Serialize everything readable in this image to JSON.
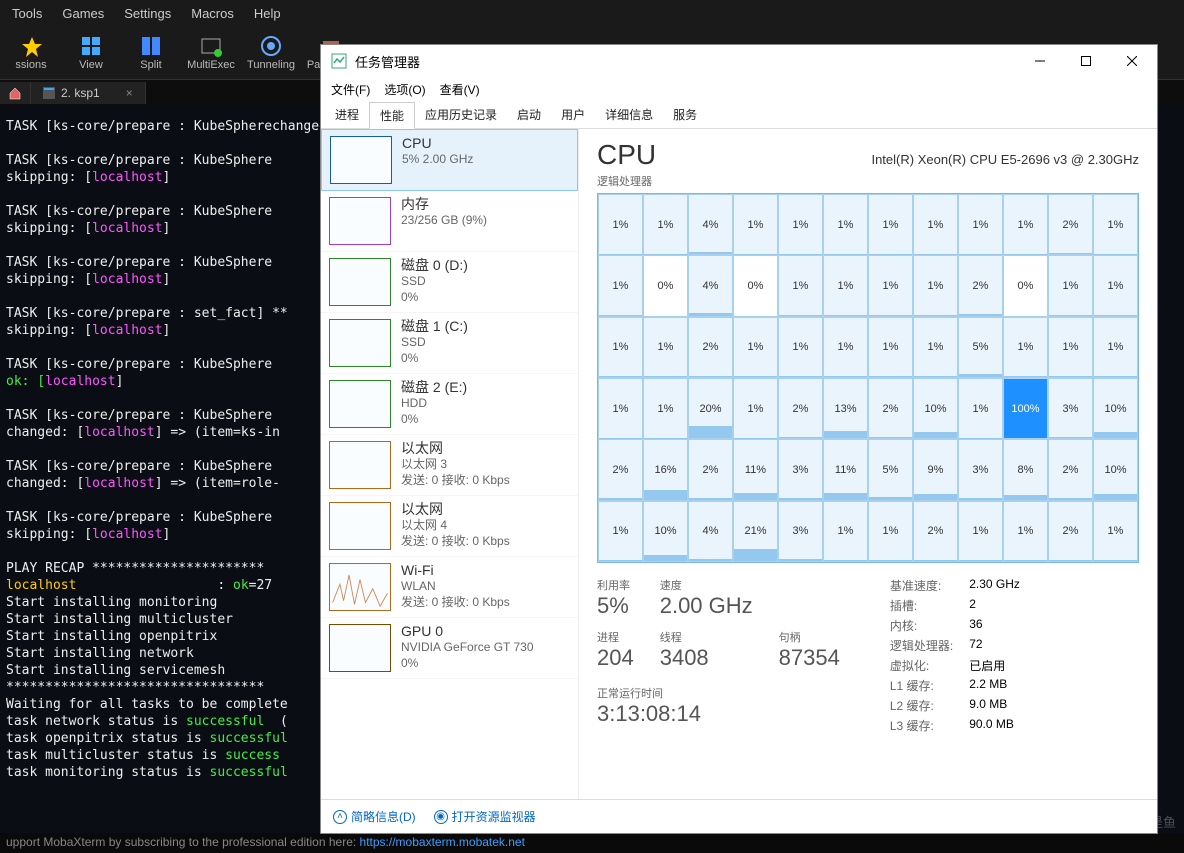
{
  "moba": {
    "menu": [
      "Tools",
      "Games",
      "Settings",
      "Macros",
      "Help"
    ],
    "toolbar": [
      {
        "label": "ssions",
        "icon": "star"
      },
      {
        "label": "View",
        "icon": "grid"
      },
      {
        "label": "Split",
        "icon": "split"
      },
      {
        "label": "MultiExec",
        "icon": "multi"
      },
      {
        "label": "Tunneling",
        "icon": "tunnel"
      },
      {
        "label": "Packages",
        "icon": "pkg"
      }
    ],
    "tab_label": "2. ksp1",
    "footer_text": "upport MobaXterm by subscribing to the professional edition here:  ",
    "footer_link": "https://mobaxterm.mobatek.net"
  },
  "terminal_lines": [
    {
      "t": "TASK [ks-core/prepare : KubeSphere",
      "c": ""
    },
    {
      "t": "changed: [",
      "c": ""
    },
    {
      "t": "localhost",
      "c": "m"
    },
    {
      "t": "]",
      "c": "",
      "nl": true
    },
    {
      "t": "",
      "nl": true
    },
    {
      "t": "TASK [ks-core/prepare : KubeSphere",
      "nl": true
    },
    {
      "t": "skipping: [",
      "c": ""
    },
    {
      "t": "localhost",
      "c": "m"
    },
    {
      "t": "]",
      "nl": true
    },
    {
      "t": "",
      "nl": true
    },
    {
      "t": "TASK [ks-core/prepare : KubeSphere",
      "nl": true
    },
    {
      "t": "skipping: [",
      "c": ""
    },
    {
      "t": "localhost",
      "c": "m"
    },
    {
      "t": "]",
      "nl": true
    },
    {
      "t": "",
      "nl": true
    },
    {
      "t": "TASK [ks-core/prepare : KubeSphere",
      "nl": true
    },
    {
      "t": "skipping: [",
      "c": ""
    },
    {
      "t": "localhost",
      "c": "m"
    },
    {
      "t": "]",
      "nl": true
    },
    {
      "t": "",
      "nl": true
    },
    {
      "t": "TASK [ks-core/prepare : set_fact] **",
      "nl": true
    },
    {
      "t": "skipping: [",
      "c": ""
    },
    {
      "t": "localhost",
      "c": "m"
    },
    {
      "t": "]",
      "nl": true
    },
    {
      "t": "",
      "nl": true
    },
    {
      "t": "TASK [ks-core/prepare : KubeSphere",
      "nl": true
    },
    {
      "t": "ok: [",
      "c": "g"
    },
    {
      "t": "localhost",
      "c": "m"
    },
    {
      "t": "]",
      "nl": true
    },
    {
      "t": "",
      "nl": true
    },
    {
      "t": "TASK [ks-core/prepare : KubeSphere",
      "nl": true
    },
    {
      "t": "changed: [",
      "c": ""
    },
    {
      "t": "localhost",
      "c": "m"
    },
    {
      "t": "] => (item=ks-in",
      "nl": true
    },
    {
      "t": "",
      "nl": true
    },
    {
      "t": "TASK [ks-core/prepare : KubeSphere",
      "nl": true
    },
    {
      "t": "changed: [",
      "c": ""
    },
    {
      "t": "localhost",
      "c": "m"
    },
    {
      "t": "] => (item=role-",
      "nl": true
    },
    {
      "t": "",
      "nl": true
    },
    {
      "t": "TASK [ks-core/prepare : KubeSphere",
      "nl": true
    },
    {
      "t": "skipping: [",
      "c": ""
    },
    {
      "t": "localhost",
      "c": "m"
    },
    {
      "t": "]",
      "nl": true
    },
    {
      "t": "",
      "nl": true
    },
    {
      "t": "PLAY RECAP **********************",
      "nl": true
    },
    {
      "t": "localhost",
      "c": "y"
    },
    {
      "t": "                  : ",
      "c": ""
    },
    {
      "t": "ok",
      "c": "g"
    },
    {
      "t": "=27",
      "nl": true
    },
    {
      "t": "Start installing monitoring",
      "nl": true
    },
    {
      "t": "Start installing multicluster",
      "nl": true
    },
    {
      "t": "Start installing openpitrix",
      "nl": true
    },
    {
      "t": "Start installing network",
      "nl": true
    },
    {
      "t": "Start installing servicemesh",
      "nl": true
    },
    {
      "t": "*********************************",
      "nl": true
    },
    {
      "t": "Waiting for all tasks to be complete",
      "nl": true
    },
    {
      "t": "task network status is ",
      "c": ""
    },
    {
      "t": "successful",
      "c": "g"
    },
    {
      "t": "  (",
      "nl": true
    },
    {
      "t": "task openpitrix status is ",
      "c": ""
    },
    {
      "t": "successful",
      "c": "g"
    },
    {
      "t": "",
      "nl": true
    },
    {
      "t": "task multicluster status is ",
      "c": ""
    },
    {
      "t": "success",
      "c": "g"
    },
    {
      "t": "",
      "nl": true
    },
    {
      "t": "task monitoring status is ",
      "c": ""
    },
    {
      "t": "successful",
      "c": "g"
    },
    {
      "t": "",
      "nl": true
    }
  ],
  "watermark": "CSDN @虎鲸不是鱼",
  "taskmgr": {
    "title": "任务管理器",
    "menu": {
      "file": "文件(F)",
      "options": "选项(O)",
      "view": "查看(V)"
    },
    "tabs": [
      "进程",
      "性能",
      "应用历史记录",
      "启动",
      "用户",
      "详细信息",
      "服务"
    ],
    "active_tab": 1,
    "sidebar": [
      {
        "name": "CPU",
        "sub": "5%  2.00 GHz",
        "type": "cpu",
        "active": true
      },
      {
        "name": "内存",
        "sub": "23/256 GB (9%)",
        "type": "mem"
      },
      {
        "name": "磁盘 0 (D:)",
        "sub": "SSD",
        "sub2": "0%",
        "type": "disk"
      },
      {
        "name": "磁盘 1 (C:)",
        "sub": "SSD",
        "sub2": "0%",
        "type": "disk"
      },
      {
        "name": "磁盘 2 (E:)",
        "sub": "HDD",
        "sub2": "0%",
        "type": "disk"
      },
      {
        "name": "以太网",
        "sub": "以太网 3",
        "sub2": "发送: 0 接收: 0 Kbps",
        "type": "net"
      },
      {
        "name": "以太网",
        "sub": "以太网 4",
        "sub2": "发送: 0 接收: 0 Kbps",
        "type": "net"
      },
      {
        "name": "Wi-Fi",
        "sub": "WLAN",
        "sub2": "发送: 0 接收: 0 Kbps",
        "type": "net",
        "spark": true
      },
      {
        "name": "GPU 0",
        "sub": "NVIDIA GeForce GT 730",
        "sub2": "0%",
        "type": "gpu"
      }
    ],
    "main": {
      "title": "CPU",
      "model": "Intel(R) Xeon(R) CPU E5-2696 v3 @ 2.30GHz",
      "subhead": "逻辑处理器",
      "cells": [
        [
          1,
          1,
          4,
          1,
          1,
          1,
          1,
          1,
          1,
          1,
          2,
          1
        ],
        [
          1,
          0,
          4,
          0,
          1,
          1,
          1,
          1,
          2,
          0,
          1,
          1
        ],
        [
          1,
          1,
          2,
          1,
          1,
          1,
          1,
          1,
          5,
          1,
          1,
          1
        ],
        [
          1,
          1,
          20,
          1,
          2,
          13,
          2,
          10,
          1,
          100,
          3,
          10
        ],
        [
          2,
          16,
          2,
          11,
          3,
          11,
          5,
          9,
          3,
          8,
          2,
          10
        ],
        [
          1,
          10,
          4,
          21,
          3,
          1,
          1,
          2,
          1,
          1,
          2,
          1
        ]
      ],
      "stats_left": [
        {
          "label": "利用率",
          "value": "5%"
        },
        {
          "label": "速度",
          "value": "2.00 GHz"
        },
        {
          "label": "",
          "value": ""
        },
        {
          "label": "进程",
          "value": "204"
        },
        {
          "label": "线程",
          "value": "3408"
        },
        {
          "label": "句柄",
          "value": "87354"
        }
      ],
      "uptime": {
        "label": "正常运行时间",
        "value": "3:13:08:14"
      },
      "stats_right": [
        [
          "基准速度:",
          "2.30 GHz"
        ],
        [
          "插槽:",
          "2"
        ],
        [
          "内核:",
          "36"
        ],
        [
          "逻辑处理器:",
          "72"
        ],
        [
          "虚拟化:",
          "已启用"
        ],
        [
          "L1 缓存:",
          "2.2 MB"
        ],
        [
          "L2 缓存:",
          "9.0 MB"
        ],
        [
          "L3 缓存:",
          "90.0 MB"
        ]
      ]
    },
    "footer": {
      "detail": "简略信息(D)",
      "resmon": "打开资源监视器"
    }
  }
}
